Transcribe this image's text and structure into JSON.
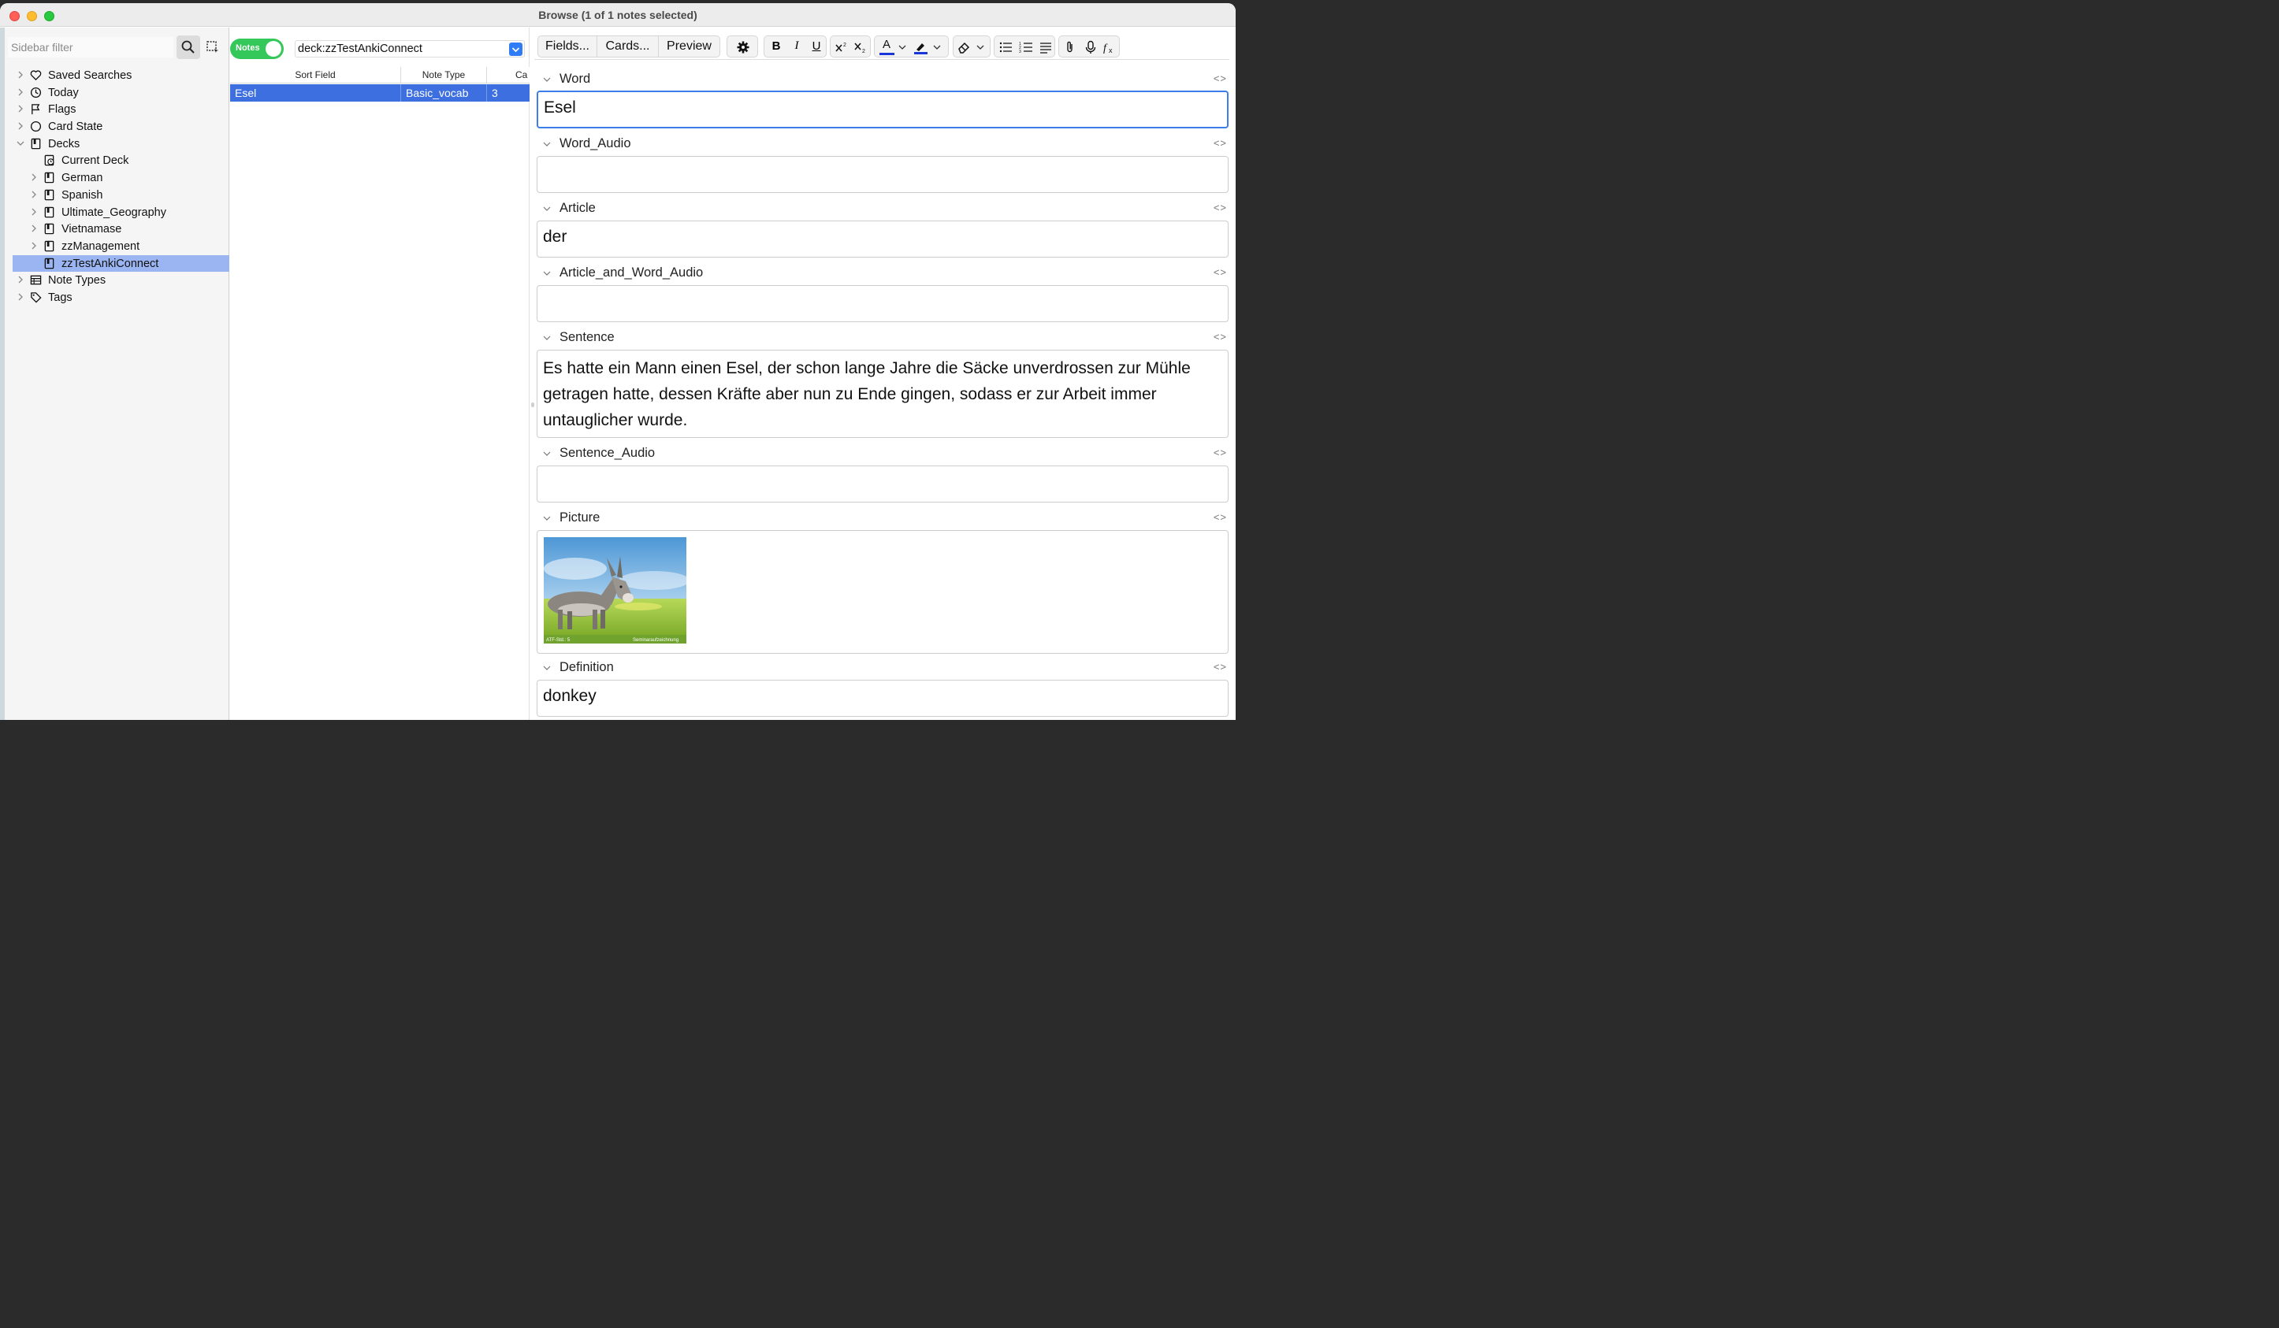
{
  "window": {
    "title": "Browse (1 of 1 notes selected)"
  },
  "sidebar": {
    "filter_placeholder": "Sidebar filter",
    "items": [
      {
        "label": "Saved Searches",
        "icon": "heart-icon"
      },
      {
        "label": "Today",
        "icon": "clock-icon"
      },
      {
        "label": "Flags",
        "icon": "flag-icon"
      },
      {
        "label": "Card State",
        "icon": "circle-icon"
      },
      {
        "label": "Decks",
        "icon": "deck-icon"
      },
      {
        "label": "Current Deck",
        "icon": "current-deck-icon"
      },
      {
        "label": "German",
        "icon": "deck-icon"
      },
      {
        "label": "Spanish",
        "icon": "deck-icon"
      },
      {
        "label": "Ultimate_Geography",
        "icon": "deck-icon"
      },
      {
        "label": "Vietnamase",
        "icon": "deck-icon"
      },
      {
        "label": "zzManagement",
        "icon": "deck-icon"
      },
      {
        "label": "zzTestAnkiConnect",
        "icon": "deck-icon"
      },
      {
        "label": "Note Types",
        "icon": "table-icon"
      },
      {
        "label": "Tags",
        "icon": "tag-icon"
      }
    ]
  },
  "browser": {
    "toggle_label": "Notes",
    "search_value": "deck:zzTestAnkiConnect",
    "columns": [
      "Sort Field",
      "Note Type",
      "Ca"
    ],
    "rows": [
      {
        "sort_field": "Esel",
        "note_type": "Basic_vocab",
        "cards": "3"
      }
    ]
  },
  "editor": {
    "toolbar": {
      "fields": "Fields...",
      "cards": "Cards...",
      "preview": "Preview",
      "bold": "B",
      "italic": "I",
      "underline": "U",
      "text_color": "A"
    },
    "code_toggle": "<>",
    "fields": [
      {
        "name": "Word",
        "value": "Esel"
      },
      {
        "name": "Word_Audio",
        "value": ""
      },
      {
        "name": "Article",
        "value": "der"
      },
      {
        "name": "Article_and_Word_Audio",
        "value": ""
      },
      {
        "name": "Sentence",
        "value": "Es hatte ein Mann einen Esel, der schon lange Jahre die Säcke unverdrossen zur Mühle getragen hatte, dessen Kräfte aber nun zu Ende gingen, sodass er zur Arbeit immer untauglicher wurde."
      },
      {
        "name": "Sentence_Audio",
        "value": ""
      },
      {
        "name": "Picture",
        "value": ""
      },
      {
        "name": "Definition",
        "value": "donkey"
      }
    ],
    "picture_caption_left": "ATF-Std.: 5",
    "picture_caption_right": "Seminaraufzeichnung"
  },
  "colors": {
    "accent": "#3d6fe0",
    "toggle_on": "#34c759",
    "sidebar_selected": "#9ab5f2"
  }
}
